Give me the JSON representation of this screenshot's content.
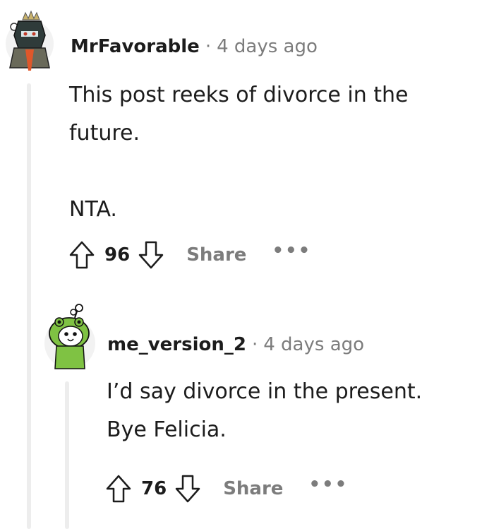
{
  "comments": [
    {
      "author": "MrFavorable",
      "separator": "·",
      "time": "4 days ago",
      "body": "This post reeks of divorce in the\nfuture.\n\nNTA.",
      "score": "96",
      "share_label": "Share",
      "more_label": "•••",
      "avatar_icon": "knight-avatar-icon"
    },
    {
      "author": "me_version_2",
      "separator": "·",
      "time": "4 days ago",
      "body": "I’d say divorce in the present.\nBye Felicia.",
      "score": "76",
      "share_label": "Share",
      "more_label": "•••",
      "avatar_icon": "frog-hood-avatar-icon"
    }
  ],
  "colors": {
    "text": "#1c1c1c",
    "muted": "#7c7c7c",
    "thread_line": "#ededed"
  }
}
